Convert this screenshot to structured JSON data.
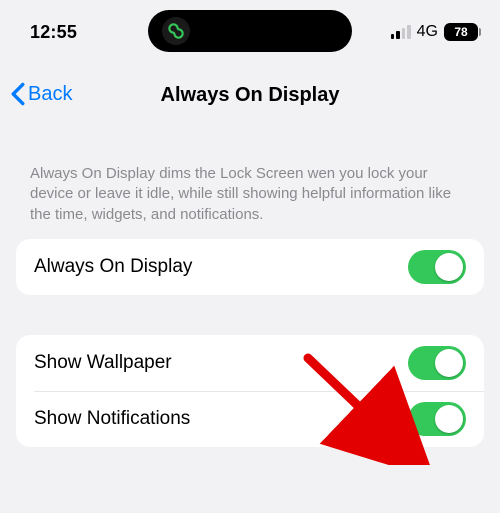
{
  "status": {
    "time": "12:55",
    "cellular_label": "4G",
    "battery_pct": "78"
  },
  "nav": {
    "back_label": "Back",
    "title": "Always On Display"
  },
  "description": "Always On Display dims the Lock Screen wen you lock your device or leave it idle, while still showing helpful information like the time, widgets, and notifications.",
  "rows": {
    "aod": "Always On Display",
    "wallpaper": "Show Wallpaper",
    "notifications": "Show Notifications"
  }
}
